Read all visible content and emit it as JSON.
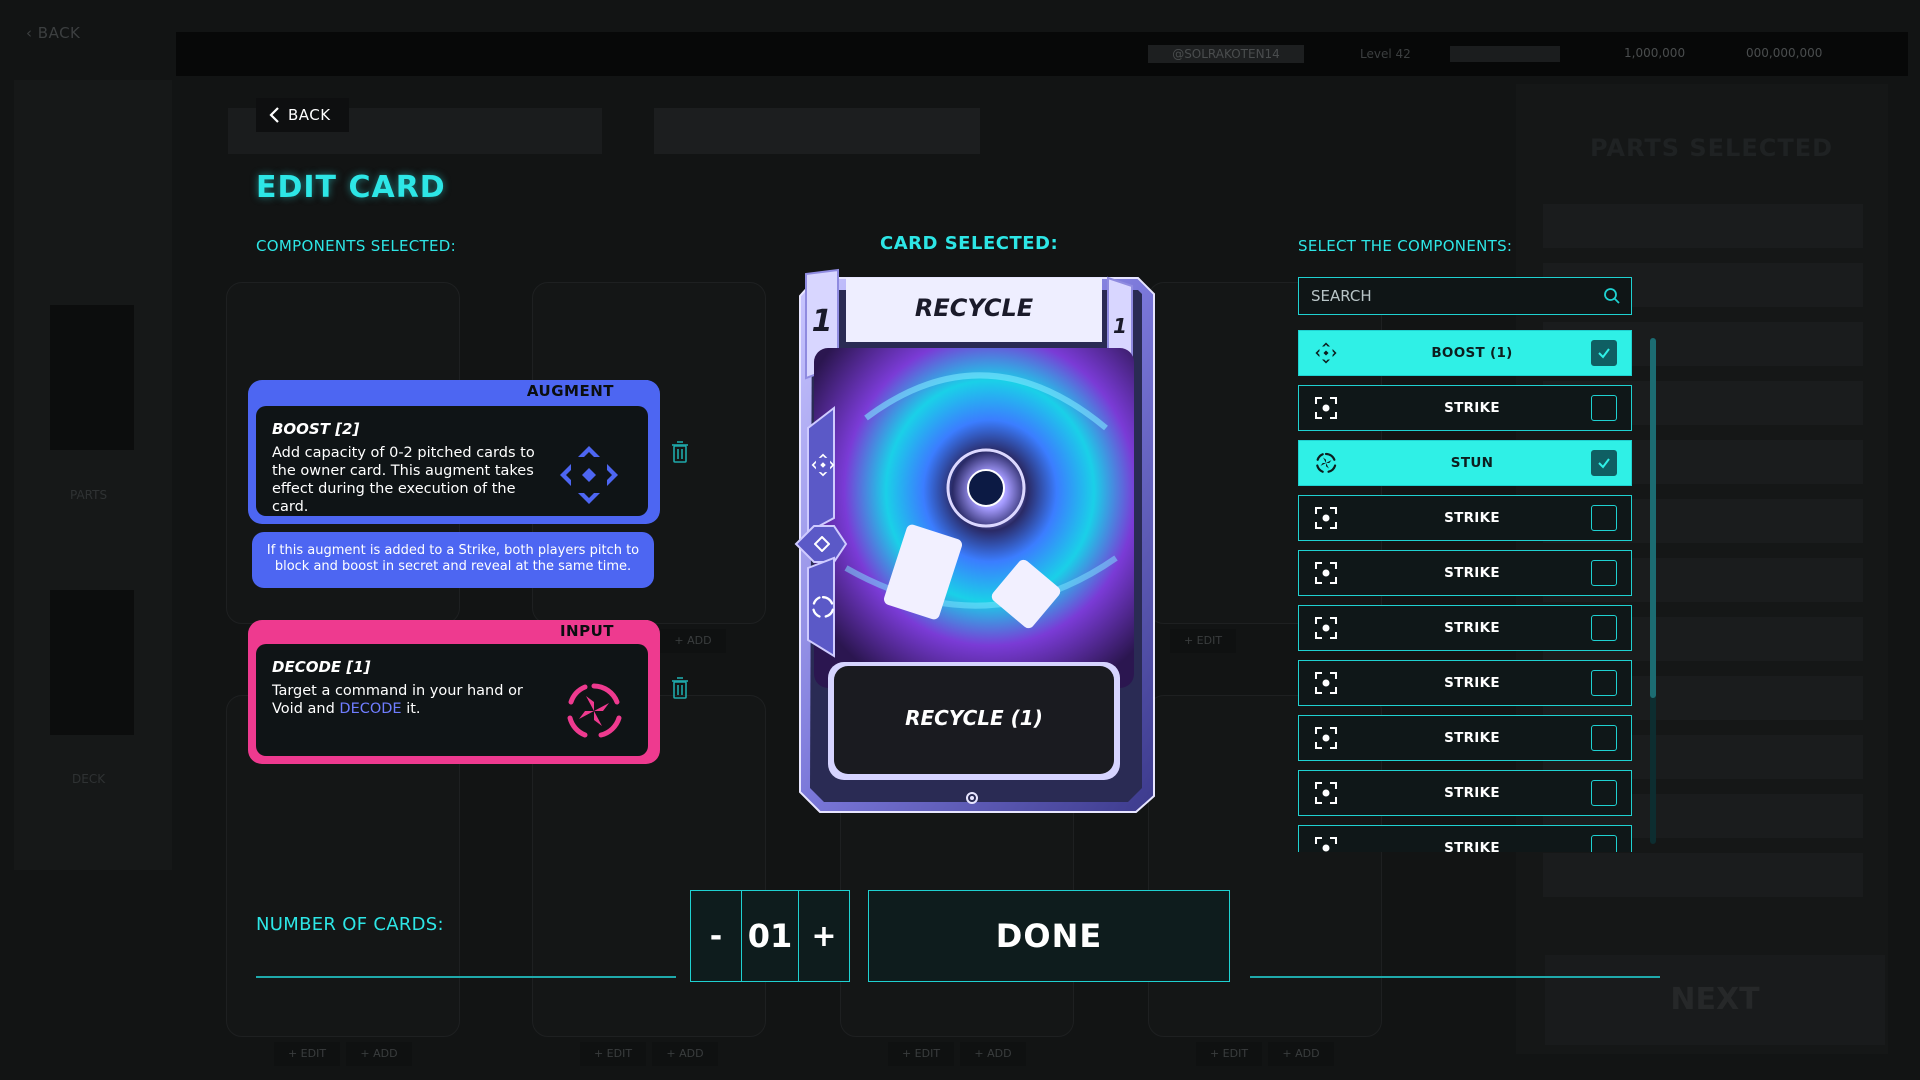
{
  "background": {
    "back_label": "BACK",
    "username": "@SOLRAKOTEN14",
    "level": "Level 42",
    "currency_1": "1,000,000",
    "currency_2": "000,000,000",
    "parts_label": "PARTS",
    "deck_label": "DECK",
    "parts_selected_title": "PARTS SELECTED",
    "next_label": "NEXT",
    "slot_edit_label": "+ EDIT",
    "slot_add_label": "+ ADD"
  },
  "header": {
    "back_label": "BACK",
    "title": "EDIT CARD"
  },
  "labels": {
    "components_selected": "COMPONENTS SELECTED:",
    "card_selected": "CARD SELECTED:",
    "select_components": "SELECT THE COMPONENTS:",
    "number_of_cards": "NUMBER OF CARDS:"
  },
  "components_selected": [
    {
      "type_tag": "AUGMENT",
      "name": "BOOST [2]",
      "description": "Add capacity of 0-2 pitched cards to the owner card. This augment takes effect during the execution of the card.",
      "note": "If this augment is added to a Strike, both players pitch to block and boost in secret and reveal at the same time.",
      "icon": "boost-icon",
      "color": "#4d66f2"
    },
    {
      "type_tag": "INPUT",
      "name": "DECODE [1]",
      "description_pre": "Target a command in your hand or Void and ",
      "description_highlight": "DECODE",
      "description_post": " it.",
      "icon": "stun-icon",
      "color": "#ee3a8f"
    }
  ],
  "card": {
    "name": "RECYCLE",
    "cost_left": "1",
    "cost_right": "1",
    "effect": "RECYCLE (1)"
  },
  "search": {
    "placeholder": "SEARCH"
  },
  "component_list": [
    {
      "name": "BOOST (1)",
      "icon": "boost-icon",
      "selected": true
    },
    {
      "name": "STRIKE",
      "icon": "strike-icon",
      "selected": false
    },
    {
      "name": "STUN",
      "icon": "stun-icon",
      "selected": true
    },
    {
      "name": "STRIKE",
      "icon": "strike-icon",
      "selected": false
    },
    {
      "name": "STRIKE",
      "icon": "strike-icon",
      "selected": false
    },
    {
      "name": "STRIKE",
      "icon": "strike-icon",
      "selected": false
    },
    {
      "name": "STRIKE",
      "icon": "strike-icon",
      "selected": false
    },
    {
      "name": "STRIKE",
      "icon": "strike-icon",
      "selected": false
    },
    {
      "name": "STRIKE",
      "icon": "strike-icon",
      "selected": false
    },
    {
      "name": "STRIKE",
      "icon": "strike-icon",
      "selected": false
    }
  ],
  "stepper": {
    "minus": "-",
    "value": "01",
    "plus": "+"
  },
  "done_label": "DONE",
  "colors": {
    "accent": "#2de6e6",
    "augment": "#4d66f2",
    "input": "#ee3a8f",
    "selected_row": "#2ff0e6"
  }
}
